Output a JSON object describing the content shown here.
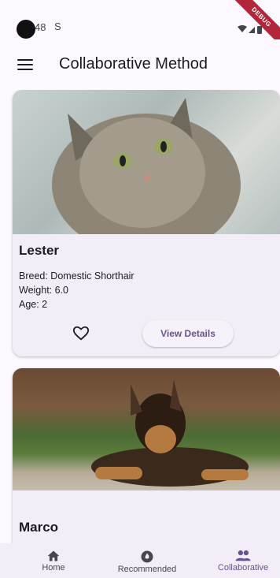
{
  "status_bar": {
    "time": "48",
    "sim_icon": "S",
    "debug_label": "DEBUG"
  },
  "app_bar": {
    "title": "Collaborative Method",
    "menu_icon": "menu-icon"
  },
  "pets": [
    {
      "name": "Lester",
      "breed": "Breed: Domestic Shorthair",
      "weight": "Weight: 6.0",
      "age": "Age: 2",
      "favorite_icon": "heart-outline-icon",
      "details_label": "View Details"
    },
    {
      "name": "Marco"
    }
  ],
  "bottom_nav": {
    "items": [
      {
        "label": "Home",
        "icon": "home-icon"
      },
      {
        "label": "Recommended",
        "icon": "recommended-icon"
      },
      {
        "label": "Collaborative",
        "icon": "group-icon",
        "active": true
      }
    ]
  },
  "colors": {
    "accent": "#65558f",
    "background": "#fdf7ff",
    "card": "#f3edf7",
    "debug": "#b3263a"
  }
}
